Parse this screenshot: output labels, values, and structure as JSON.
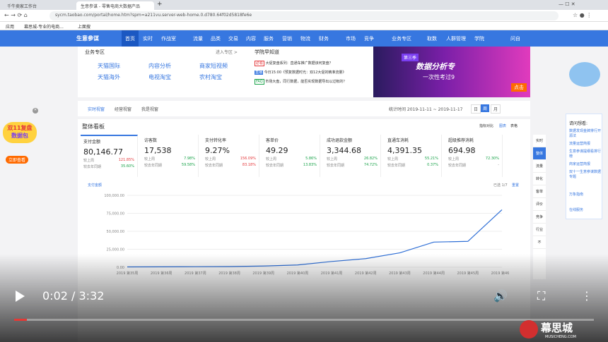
{
  "browser": {
    "tabs": [
      "千牛卖家工作台",
      "生意参谋 - 零售电商大数据产品"
    ],
    "url": "sycm.taobao.com/portal/home.htm?spm=a211vu.server-web-home.0.d780.64f02d5818fe6e",
    "bookmarks": [
      "应用",
      "幕思城-专业的电商...",
      "上面搜"
    ]
  },
  "nav": {
    "brand": "生意参谋",
    "items": [
      "首页",
      "实时",
      "作战室",
      "流量",
      "品类",
      "交易",
      "内容",
      "服务",
      "营销",
      "物流",
      "财务",
      "市场",
      "竞争",
      "业务专区",
      "取数",
      "人群管理",
      "学院"
    ],
    "user": "问自"
  },
  "services": {
    "title": "业务专区",
    "enter": "进入专区 >",
    "links": [
      "天猫国际",
      "内容分析",
      "商家短视频",
      "天猫海外",
      "电视淘宝",
      "农村淘宝"
    ],
    "early_title": "学院早知道",
    "news": [
      {
        "tag": "必看",
        "text": "大促复盘系列：直通车推广数据该何复盘？"
      },
      {
        "tag": "直播",
        "text": "今日15:00《预复数据时光：双12大促的精准流量》"
      },
      {
        "tag": "FAQ",
        "text": "市场大盘，同行数据，能否实现数据导出以过帐的？"
      }
    ]
  },
  "banner": {
    "tag": "第三季",
    "title": "数据分析专",
    "sub": "一次性考过9",
    "btn": "点击"
  },
  "datebar": {
    "tabs": [
      "实时视窗",
      "经营视窗",
      "我是视窗"
    ],
    "stat": "统计时间 2019-11-11 ~ 2019-11-17",
    "periods": [
      "日",
      "周",
      "月"
    ]
  },
  "overview": {
    "title": "整体看板",
    "actions": [
      "指标对比",
      "图表",
      "表格"
    ],
    "metrics": [
      {
        "label": "支付金额",
        "value": "80,146.77",
        "a": "121.85%",
        "a_dir": "up",
        "b": "35.60%",
        "b_dir": "dn"
      },
      {
        "label": "访客数",
        "value": "17,538",
        "a": "7.98%",
        "a_dir": "dn",
        "b": "59.58%",
        "b_dir": "dn"
      },
      {
        "label": "支付转化率",
        "value": "9.27%",
        "a": "156.09%",
        "a_dir": "up",
        "b": "83.18%",
        "b_dir": "up"
      },
      {
        "label": "客单价",
        "value": "49.29",
        "a": "5.86%",
        "a_dir": "dn",
        "b": "13.83%",
        "b_dir": "dn"
      },
      {
        "label": "成功退款金额",
        "value": "3,344.68",
        "a": "26.82%",
        "a_dir": "dn",
        "b": "74.72%",
        "b_dir": "dn"
      },
      {
        "label": "直通车消耗",
        "value": "4,391.35",
        "a": "55.21%",
        "a_dir": "dn",
        "b": "0.37%",
        "b_dir": "dn"
      },
      {
        "label": "超级推荐消耗",
        "value": "694.98",
        "a": "72.30%",
        "a_dir": "dn",
        "b": "-",
        "b_dir": ""
      }
    ],
    "row_a": "较上周",
    "row_b": "较去年同期",
    "legend": "支付金额",
    "selected": "已选 1/7",
    "reset": "重置"
  },
  "chart_data": {
    "type": "line",
    "x": [
      "2019 第35周",
      "2019 第36周",
      "2019 第37周",
      "2019 第38周",
      "2019 第39周",
      "2019 第40周",
      "2019 第41周",
      "2019 第42周",
      "2019 第43周",
      "2019 第44周",
      "2019 第45周",
      "2019 第46周"
    ],
    "series": [
      {
        "name": "支付金额",
        "values": [
          500,
          600,
          800,
          1000,
          1700,
          3200,
          8000,
          12000,
          20000,
          35000,
          36000,
          80000
        ]
      }
    ],
    "yticks": [
      "0.00",
      "25,000.00",
      "50,000.00",
      "75,000.00",
      "100,000.00"
    ],
    "ylim": [
      0,
      100000
    ],
    "grid": true
  },
  "rail": [
    "实时",
    "整体",
    "流量",
    "转化",
    "客单",
    "评价",
    "竞争",
    "行业",
    "不"
  ],
  "question": {
    "title": "请问想看:",
    "items": [
      "数据发现金牌排行开源法",
      "流量运营简报",
      "生意参谋提纲看排行榜",
      "商家运营简报",
      "双十一生意参谋数据专题"
    ],
    "b1": "万象指南",
    "b2": "在线服务"
  },
  "promo": {
    "line1": "双11复盘",
    "line2": "数据包",
    "btn": "立即查看"
  },
  "video": {
    "time": "0:02 / 3:32",
    "logo": "幕思城",
    "logo_sub": "MUSICHENG.COM"
  }
}
